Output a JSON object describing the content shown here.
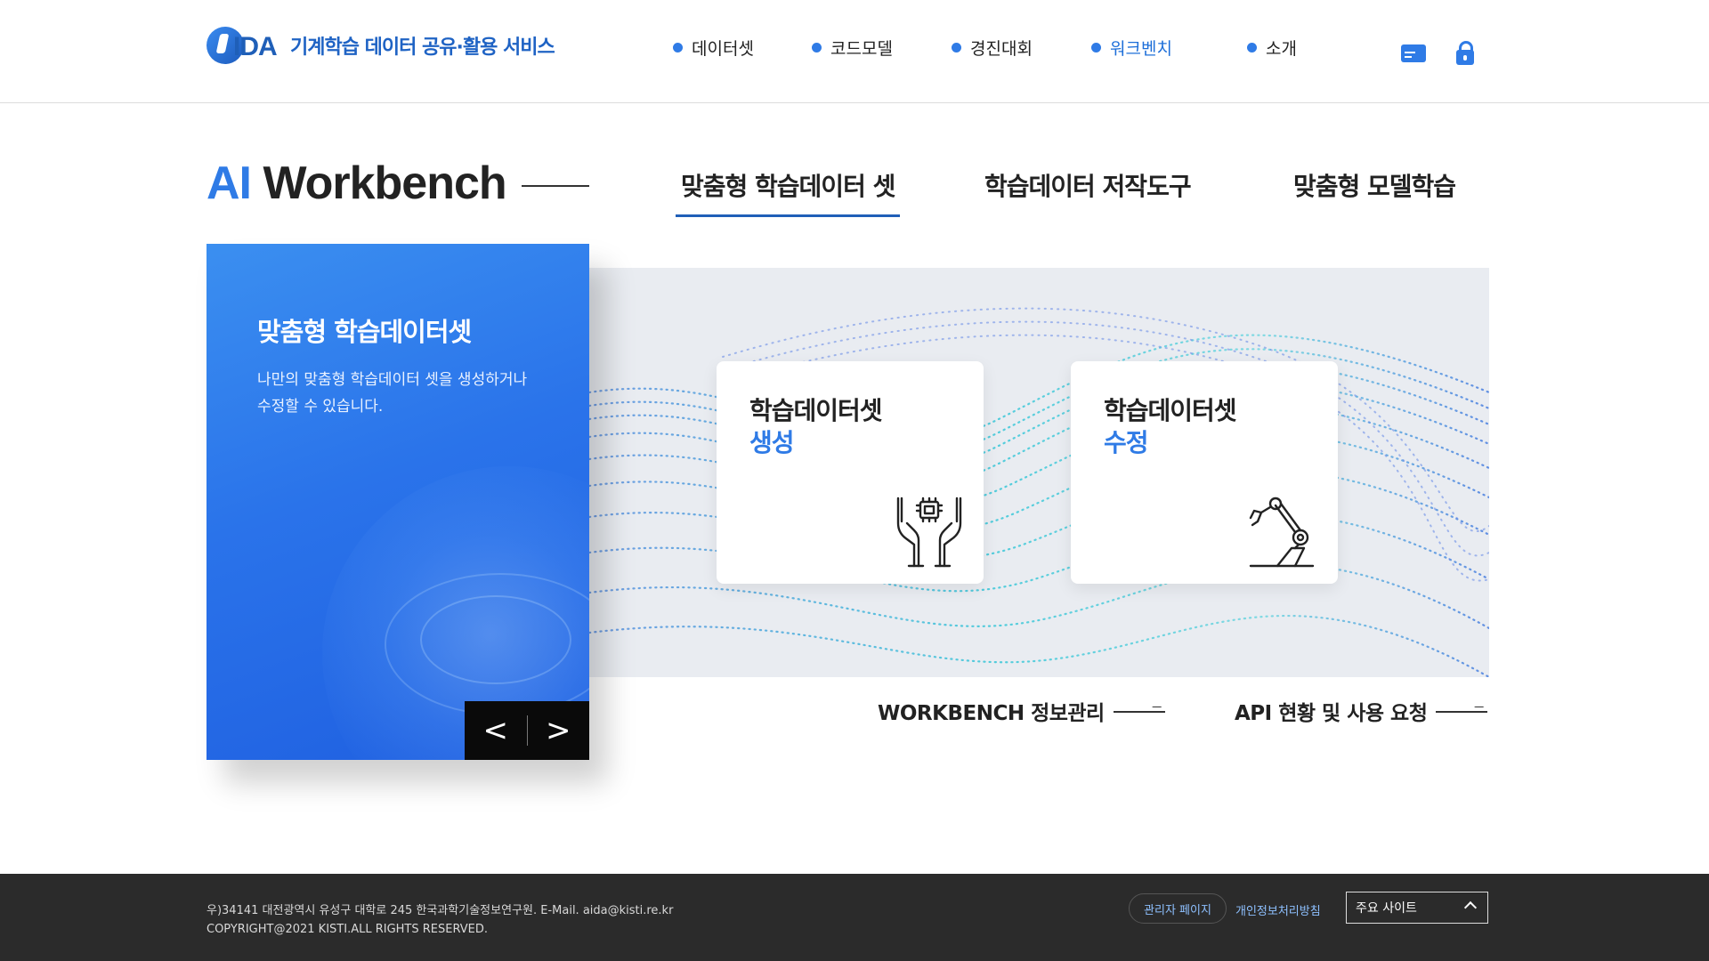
{
  "header": {
    "logo_mark": "IDA",
    "logo_text": "기계학습 데이터 공유·활용 서비스",
    "nav": [
      {
        "label": "데이터셋",
        "active": false
      },
      {
        "label": "코드모델",
        "active": false
      },
      {
        "label": "경진대회",
        "active": false
      },
      {
        "label": "워크벤치",
        "active": true
      },
      {
        "label": "소개",
        "active": false
      }
    ],
    "icons": [
      "membership-card-icon",
      "lock-icon"
    ]
  },
  "section": {
    "title_ai": "AI",
    "title_rest": " Workbench",
    "tabs": [
      {
        "label": "맞춤형 학습데이터 셋",
        "active": true
      },
      {
        "label": "학습데이터 저작도구",
        "active": false
      },
      {
        "label": "맞춤형 모델학습",
        "active": false
      }
    ]
  },
  "panel": {
    "title": "맞춤형 학습데이터셋",
    "desc_line1": "나만의 맞춤형 학습데이터 셋을 생성하거나",
    "desc_line2": "수정할 수 있습니다.",
    "prev": "<",
    "next": ">"
  },
  "cards": [
    {
      "line1": "학습데이터셋",
      "line2": "생성",
      "icon": "hands-chip-icon"
    },
    {
      "line1": "학습데이터셋",
      "line2": "수정",
      "icon": "robot-arm-icon"
    }
  ],
  "links": [
    {
      "label": "WORKBENCH 정보관리"
    },
    {
      "label": "API 현황 및 사용 요청"
    }
  ],
  "footer": {
    "address": "우)34141 대전광역시 유성구 대학로 245 한국과학기술정보연구원.   E-Mail. aida@kisti.re.kr",
    "copyright": "COPYRIGHT@2021 KISTI.ALL RIGHTS RESERVED.",
    "admin": "관리자 페이지",
    "privacy": "개인정보처리방침",
    "family_site": "주요 사이트"
  },
  "colors": {
    "accent": "#2f7be6",
    "brand": "#1f5fb8",
    "footer_bg": "#2b2b2b",
    "panel_gray": "#e9ecf1"
  }
}
